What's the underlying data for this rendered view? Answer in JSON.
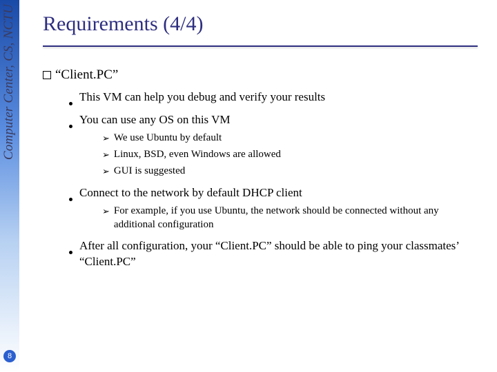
{
  "sidebar": {
    "org_text": "Computer Center, CS, NCTU",
    "page_number": "8"
  },
  "title": "Requirements (4/4)",
  "body": {
    "topic": "“Client.PC”",
    "b1": "This VM can help you debug and verify your results",
    "b2": "You can use any OS on this VM",
    "b2a": "We use Ubuntu by default",
    "b2b": "Linux, BSD, even Windows are allowed",
    "b2c": "GUI is suggested",
    "b3": "Connect to the network by default DHCP client",
    "b3a": "For example, if you use Ubuntu, the network should be connected without any additional configuration",
    "b4": "After all configuration, your “Client.PC” should be able to ping your classmates’ “Client.PC”"
  }
}
